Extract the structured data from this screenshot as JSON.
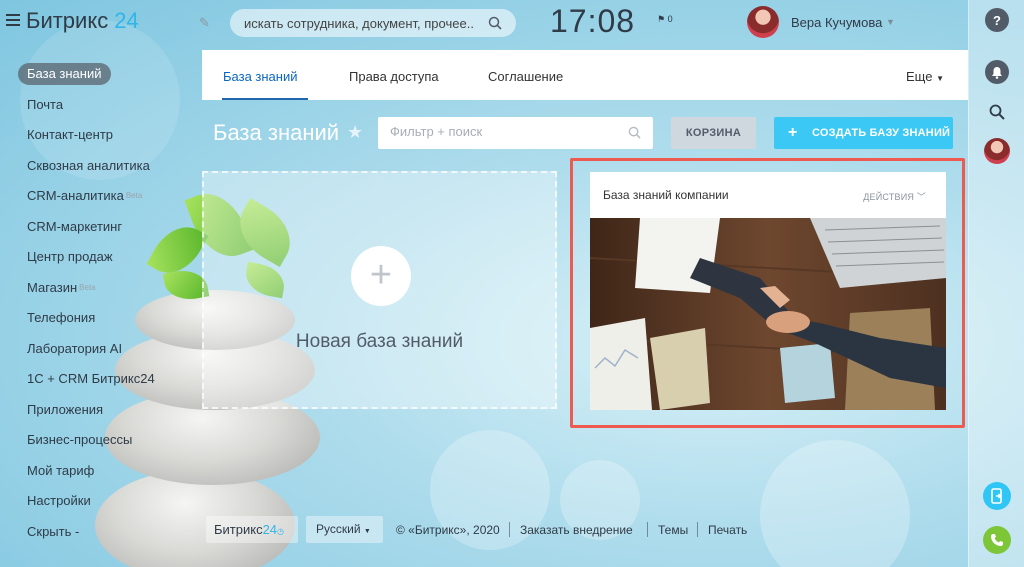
{
  "header": {
    "logo_text": "Битрикс",
    "logo_num": "24",
    "search_placeholder": "искать сотрудника, документ, прочее...",
    "time": "17:08",
    "flag_count": "0",
    "user_name": "Вера Кучумова"
  },
  "sidebar": {
    "items": [
      {
        "label": "База знаний",
        "active": true
      },
      {
        "label": "Почта"
      },
      {
        "label": "Контакт-центр"
      },
      {
        "label": "Сквозная аналитика"
      },
      {
        "label": "CRM-аналитика",
        "badge": "Beta"
      },
      {
        "label": "CRM-маркетинг"
      },
      {
        "label": "Центр продаж"
      },
      {
        "label": "Магазин",
        "badge": "Beta"
      },
      {
        "label": "Телефония"
      },
      {
        "label": "Лаборатория AI"
      },
      {
        "label": "1С + CRM Битрикс24"
      },
      {
        "label": "Приложения"
      },
      {
        "label": "Бизнес-процессы"
      },
      {
        "label": "Мой тариф"
      },
      {
        "label": "Настройки"
      },
      {
        "label": "Скрыть -"
      }
    ]
  },
  "tabs": {
    "items": [
      "База знаний",
      "Права доступа",
      "Соглашение"
    ],
    "more": "Еще"
  },
  "main": {
    "title": "База знаний",
    "filter_placeholder": "Фильтр + поиск",
    "trash_button": "КОРЗИНА",
    "create_button": "СОЗДАТЬ БАЗУ ЗНАНИЙ",
    "new_kb_label": "Новая база знаний",
    "kb_card": {
      "title": "База знаний компании",
      "actions": "ДЕЙСТВИЯ"
    }
  },
  "footer": {
    "logo_text": "Битрикс",
    "logo_num": "24",
    "language": "Русский",
    "copyright": "© «Битрикс», 2020",
    "links": [
      "Заказать внедрение",
      "Темы",
      "Печать"
    ]
  },
  "colors": {
    "accent": "#3bc8f5",
    "highlight": "#ee5a4f",
    "active_tab": "#2067b0"
  }
}
